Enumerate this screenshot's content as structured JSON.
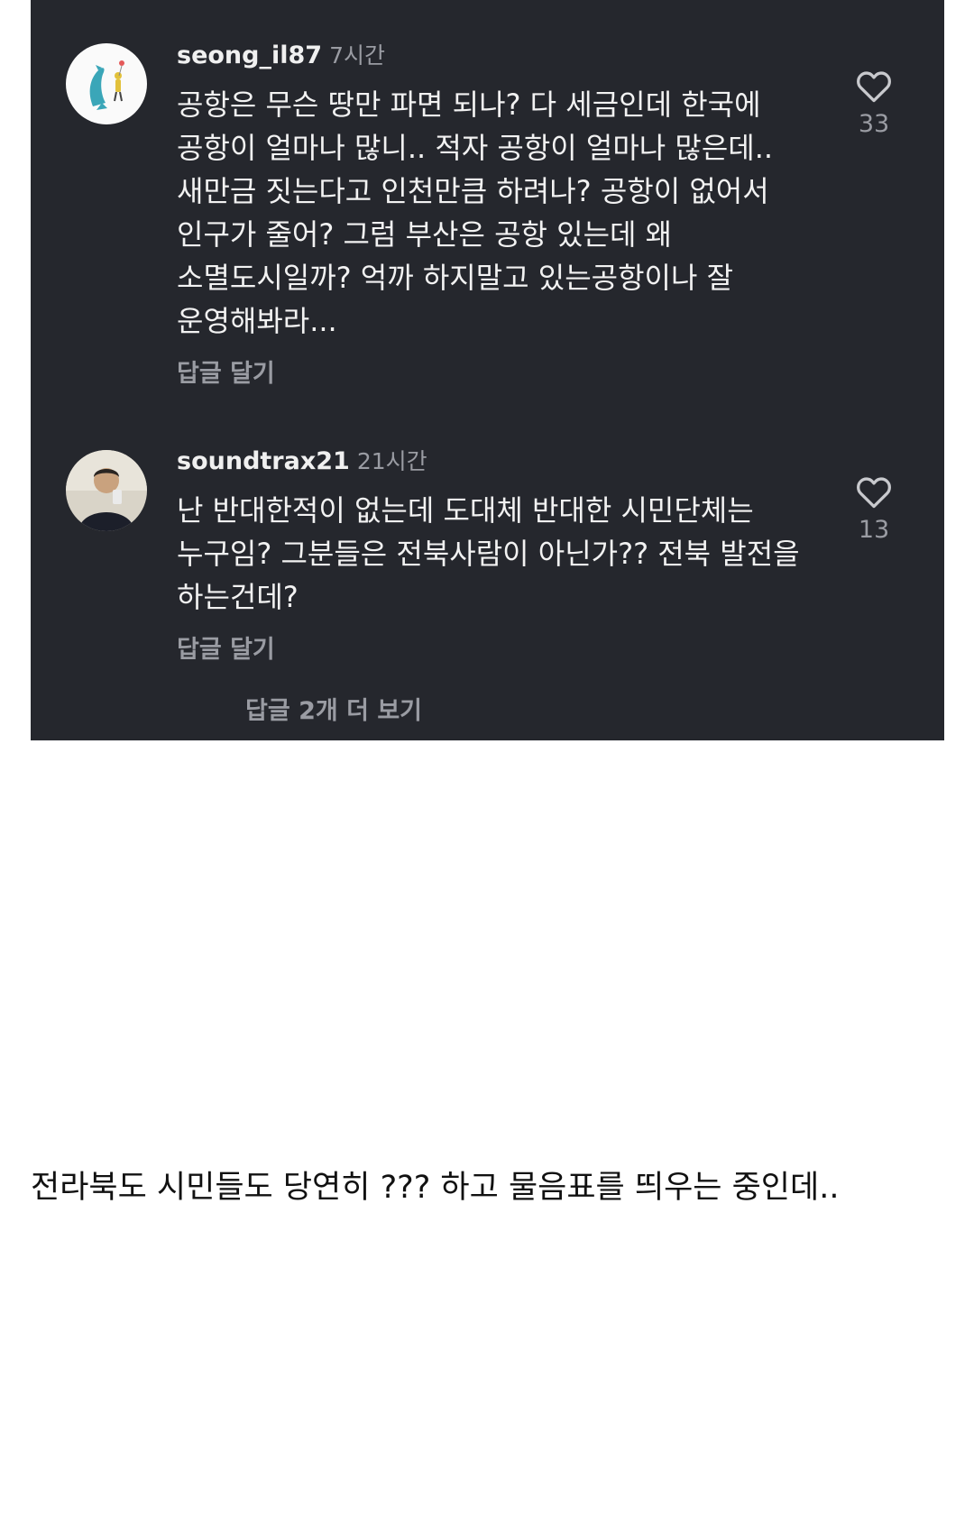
{
  "comments": [
    {
      "username": "seong_il87",
      "time": "7시간",
      "lines": [
        "공항은 무슨 땅만 파면 되나? 다 세금인데 한국에",
        "공항이 얼마나 많니.. 적자 공항이 얼마나 많은데..",
        "새만금 짓는다고 인천만큼 하려나? 공항이 없어서",
        "인구가 줄어? 그럼 부산은 공항 있는데 왜",
        "소멸도시일까? 억까 하지말고 있는공항이나 잘",
        "운영해봐라..."
      ],
      "reply_label": "답글 달기",
      "likes": "33"
    },
    {
      "username": "soundtrax21",
      "time": "21시간",
      "lines": [
        "난 반대한적이 없는데 도대체 반대한 시민단체는",
        "누구임? 그분들은 전북사람이 아닌가?? 전북 발전을",
        "하는건데?"
      ],
      "reply_label": "답글 달기",
      "likes": "13"
    }
  ],
  "more_replies": "답글 2개 더 보기",
  "caption": "전라북도 시민들도 당연히 ??? 하고 물음표를 띄우는 중인데..",
  "icons": {
    "like": "heart-outline-icon"
  },
  "colors": {
    "panel_bg": "#25272d",
    "text_primary": "#f2f2f2",
    "text_secondary": "#9a9ca3",
    "page_bg": "#ffffff",
    "caption_text": "#111111"
  }
}
